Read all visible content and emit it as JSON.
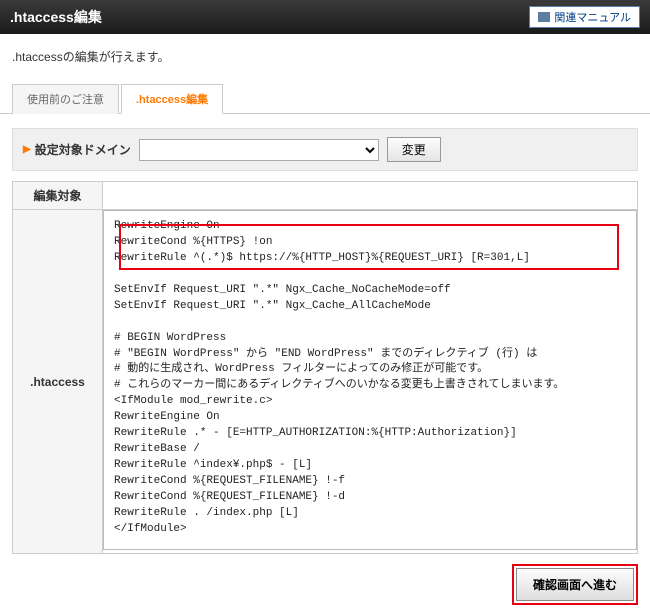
{
  "header": {
    "title": ".htaccess編集",
    "manual_link": "関連マニュアル"
  },
  "description": ".htaccessの編集が行えます。",
  "tabs": {
    "notice": "使用前のご注意",
    "edit": ".htaccess編集"
  },
  "domain": {
    "label": "設定対象ドメイン",
    "selected": "",
    "change_button": "変更"
  },
  "table": {
    "edit_target_label": "編集対象",
    "htaccess_label": ".htaccess"
  },
  "editor_content": "RewriteEngine On\nRewriteCond %{HTTPS} !on\nRewriteRule ^(.*)$ https://%{HTTP_HOST}%{REQUEST_URI} [R=301,L]\n\nSetEnvIf Request_URI \".*\" Ngx_Cache_NoCacheMode=off\nSetEnvIf Request_URI \".*\" Ngx_Cache_AllCacheMode\n\n# BEGIN WordPress\n# \"BEGIN WordPress\" から \"END WordPress\" までのディレクティブ (行) は\n# 動的に生成され、WordPress フィルターによってのみ修正が可能です。\n# これらのマーカー間にあるディレクティブへのいかなる変更も上書きされてしまいます。\n<IfModule mod_rewrite.c>\nRewriteEngine On\nRewriteRule .* - [E=HTTP_AUTHORIZATION:%{HTTP:Authorization}]\nRewriteBase /\nRewriteRule ^index¥.php$ - [L]\nRewriteCond %{REQUEST_FILENAME} !-f\nRewriteCond %{REQUEST_FILENAME} !-d\nRewriteRule . /index.php [L]\n</IfModule>\n\n# END WordPress\n",
  "footer": {
    "confirm_button": "確認画面へ進む"
  }
}
